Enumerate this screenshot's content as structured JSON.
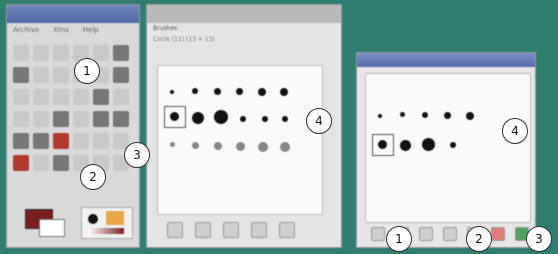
{
  "toolbox": {
    "menu": [
      "Archivo",
      "Xtns",
      "Help"
    ],
    "callouts": [
      "1",
      "2",
      "3"
    ]
  },
  "brushes_dialog": {
    "header": "Brushes",
    "subheader": "Circle (11) (13 × 13)",
    "callout": "4"
  },
  "small_dialog": {
    "callouts": [
      "4",
      "1",
      "2",
      "3"
    ]
  }
}
